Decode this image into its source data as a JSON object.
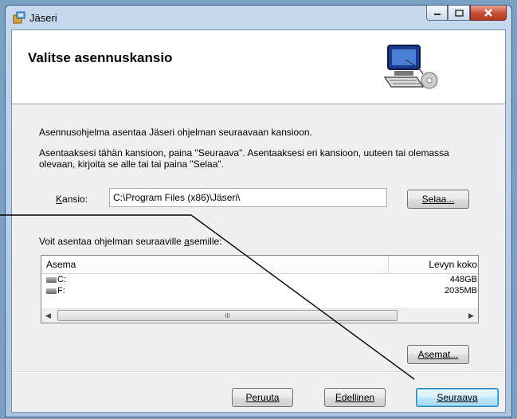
{
  "window": {
    "title": "Jäseri"
  },
  "banner": {
    "title": "Valitse asennuskansio"
  },
  "content": {
    "intro": "Asennusohjelma asentaa Jäseri ohjelman seuraavaan kansioon.",
    "instructions": "Asentaaksesi tähän kansioon, paina \"Seuraava\". Asentaaksesi eri kansioon, uuteen tai olemassa olevaan, kirjoita se alle tai tai paina \"Selaa\".",
    "folder_label_accel": "K",
    "folder_label_rest": "ansio:",
    "folder_path": "C:\\Program Files (x86)\\Jäseri\\",
    "browse_label": "Selaa...",
    "drives_caption_pre": "Voit asentaa ohjelman seuraaville ",
    "drives_caption_accel": "a",
    "drives_caption_post": "semille:",
    "drive_table": {
      "headers": [
        "Asema",
        "Levyn koko"
      ],
      "rows": [
        {
          "name": "C:",
          "size": "448GB"
        },
        {
          "name": "F:",
          "size": "2035MB"
        }
      ]
    },
    "scroll_thumb_glyph": "III",
    "drives_button_label": "Asemat..."
  },
  "footer": {
    "cancel_label": "Peruuta",
    "back_label": "Edellinen",
    "next_label": "Seuraava"
  },
  "icons": {
    "app": "installer-icon",
    "banner": "computer-cd-icon",
    "minimize": "minimize-icon",
    "maximize": "maximize-icon",
    "close": "close-icon",
    "drive": "drive-icon",
    "scroll_left": "scroll-left-icon",
    "scroll_right": "scroll-right-icon"
  },
  "colors": {
    "close_button": "#c74a33",
    "default_button_border": "#3c7fb1",
    "annotation_line": "#000000"
  }
}
